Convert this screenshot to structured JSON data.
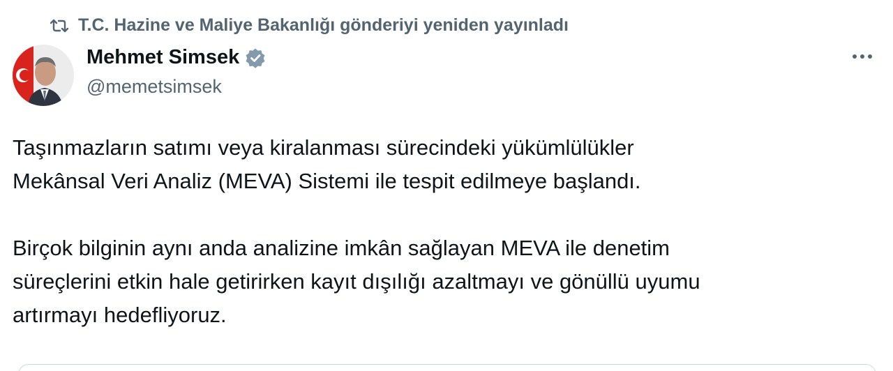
{
  "repost": {
    "icon": "repost-icon",
    "text": "T.C. Hazine ve Maliye Bakanlığı gönderiyi yeniden yayınladı"
  },
  "author": {
    "name": "Mehmet Simsek",
    "handle": "@memetsimsek",
    "verified": true,
    "verified_color": "#829aab"
  },
  "post": {
    "paragraph_1_line_1": "Taşınmazların satımı veya kiralanması sürecindeki yükümlülükler",
    "paragraph_1_line_2": "Mekânsal Veri Analiz (MEVA) Sistemi ile tespit edilmeye başlandı.",
    "paragraph_2_line_1": "Birçok bilginin aynı anda analizine imkân sağlayan MEVA ile denetim",
    "paragraph_2_line_2": "süreçlerini etkin hale getirirken kayıt dışılığı azaltmayı ve gönüllü uyumu",
    "paragraph_2_line_3": "artırmayı hedefliyoruz."
  },
  "colors": {
    "text": "#0f1419",
    "secondary": "#536471",
    "border": "#cfd9de"
  }
}
